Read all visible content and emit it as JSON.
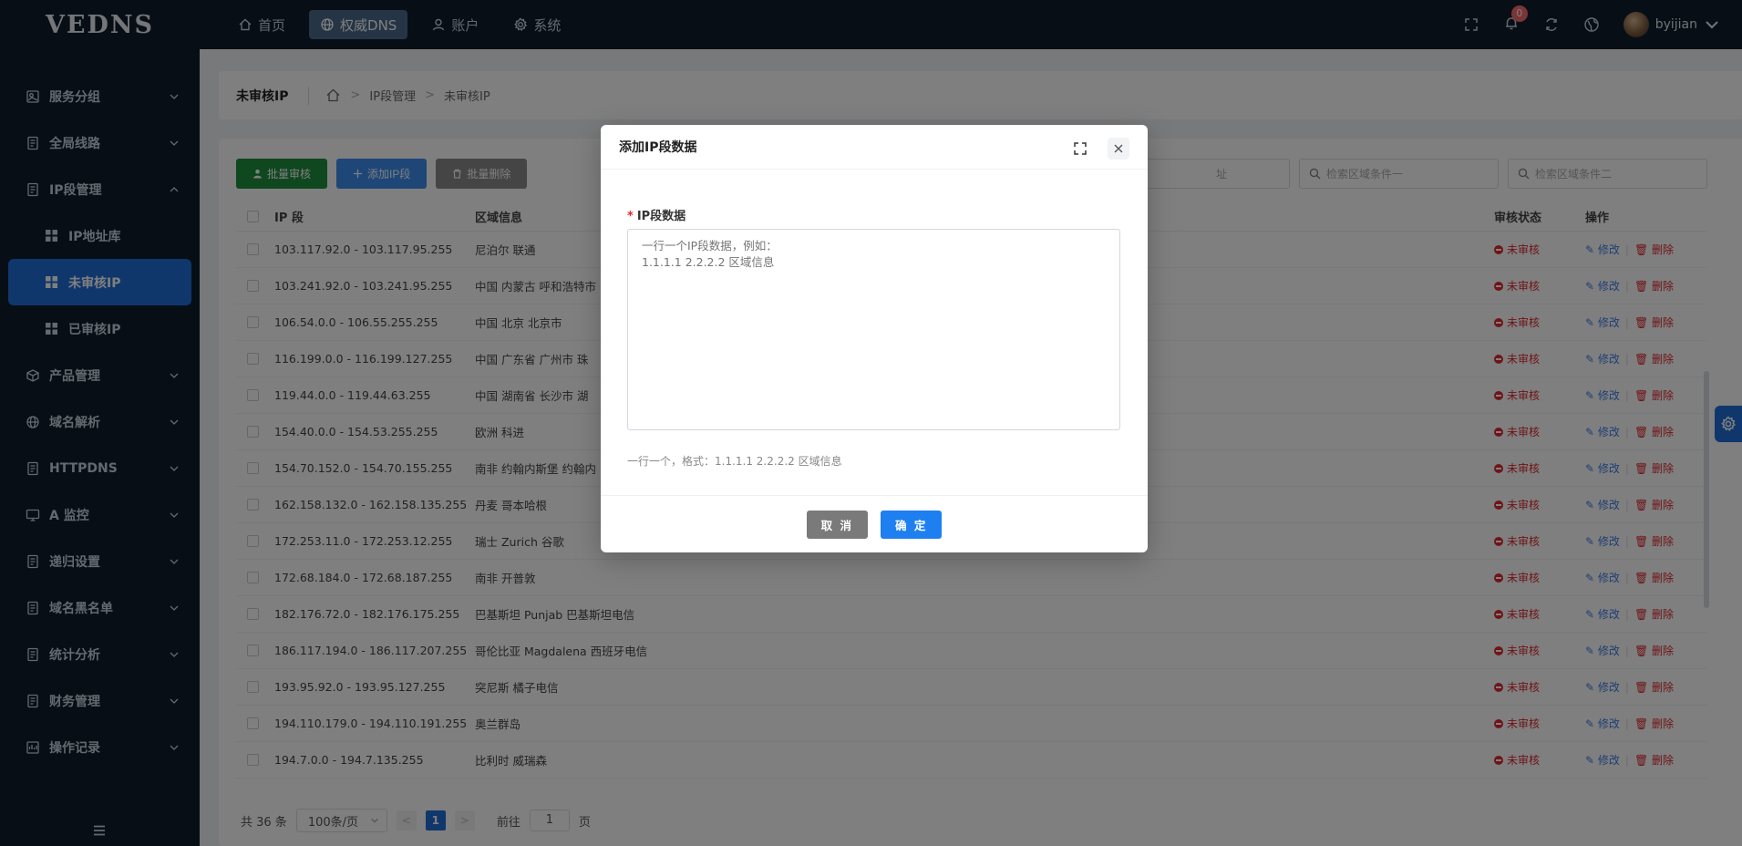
{
  "app": {
    "logo": "VEDNS"
  },
  "topnav": [
    {
      "label": "首页",
      "icon": "home-icon",
      "active": false
    },
    {
      "label": "权威DNS",
      "icon": "globe-icon",
      "active": true
    },
    {
      "label": "账户",
      "icon": "user-icon",
      "active": false
    },
    {
      "label": "系统",
      "icon": "gear-icon",
      "active": false
    }
  ],
  "topright": {
    "notification_count": "0",
    "username": "byijian"
  },
  "sidebar": {
    "items": [
      {
        "label": "服务分组",
        "icon": "server-group-icon"
      },
      {
        "label": "全局线路",
        "icon": "document-icon"
      },
      {
        "label": "IP段管理",
        "icon": "document-icon",
        "expanded": true
      },
      {
        "label": "产品管理",
        "icon": "box-icon"
      },
      {
        "label": "域名解析",
        "icon": "globe-icon"
      },
      {
        "label": "HTTPDNS",
        "icon": "document-icon"
      },
      {
        "label": "A 监控",
        "icon": "monitor-icon"
      },
      {
        "label": "递归设置",
        "icon": "document-icon"
      },
      {
        "label": "域名黑名单",
        "icon": "document-icon"
      },
      {
        "label": "统计分析",
        "icon": "document-icon"
      },
      {
        "label": "财务管理",
        "icon": "document-icon"
      },
      {
        "label": "操作记录",
        "icon": "log-icon"
      }
    ],
    "subitems": [
      {
        "label": "IP地址库"
      },
      {
        "label": "未审核IP",
        "active": true
      },
      {
        "label": "已审核IP"
      }
    ]
  },
  "breadcrumb": {
    "title": "未审核IP",
    "path": [
      "IP段管理",
      "未审核IP"
    ]
  },
  "toolbar": {
    "batch_approve": "批量审核",
    "add_ip": "添加IP段",
    "batch_delete": "批量删除"
  },
  "search": {
    "field1_placeholder": "址",
    "field2_placeholder": "检索区域条件一",
    "field3_placeholder": "检索区域条件二"
  },
  "table": {
    "headers": {
      "ip": "IP 段",
      "area": "区域信息",
      "status": "审核状态",
      "op": "操作"
    },
    "status_label": "未审核",
    "edit_label": "修改",
    "delete_label": "删除",
    "rows": [
      {
        "ip": "103.117.92.0 - 103.117.95.255",
        "area": "尼泊尔 联通"
      },
      {
        "ip": "103.241.92.0 - 103.241.95.255",
        "area": "中国 内蒙古 呼和浩特市"
      },
      {
        "ip": "106.54.0.0 - 106.55.255.255",
        "area": "中国 北京 北京市"
      },
      {
        "ip": "116.199.0.0 - 116.199.127.255",
        "area": "中国 广东省 广州市 珠"
      },
      {
        "ip": "119.44.0.0 - 119.44.63.255",
        "area": "中国 湖南省 长沙市 湖"
      },
      {
        "ip": "154.40.0.0 - 154.53.255.255",
        "area": "欧洲 科进"
      },
      {
        "ip": "154.70.152.0 - 154.70.155.255",
        "area": "南非 约翰内斯堡 约翰内"
      },
      {
        "ip": "162.158.132.0 - 162.158.135.255",
        "area": "丹麦 哥本哈根"
      },
      {
        "ip": "172.253.11.0 - 172.253.12.255",
        "area": "瑞士 Zurich 谷歌"
      },
      {
        "ip": "172.68.184.0 - 172.68.187.255",
        "area": "南非 开普敦"
      },
      {
        "ip": "182.176.72.0 - 182.176.175.255",
        "area": "巴基斯坦 Punjab 巴基斯坦电信"
      },
      {
        "ip": "186.117.194.0 - 186.117.207.255",
        "area": "哥伦比亚 Magdalena 西班牙电信"
      },
      {
        "ip": "193.95.92.0 - 193.95.127.255",
        "area": "突尼斯 橘子电信"
      },
      {
        "ip": "194.110.179.0 - 194.110.191.255",
        "area": "奥兰群岛"
      },
      {
        "ip": "194.7.0.0 - 194.7.135.255",
        "area": "比利时 威瑞森"
      }
    ]
  },
  "pagination": {
    "total": "共 36 条",
    "page_size": "100条/页",
    "current": "1",
    "goto_prefix": "前往",
    "goto_value": "1",
    "goto_suffix": "页"
  },
  "modal": {
    "title": "添加IP段数据",
    "field_label": "IP段数据",
    "placeholder": "一行一个IP段数据，例如：\n1.1.1.1 2.2.2.2 区域信息",
    "hint": "一行一个，格式：1.1.1.1 2.2.2.2 区域信息",
    "cancel": "取 消",
    "confirm": "确 定"
  }
}
